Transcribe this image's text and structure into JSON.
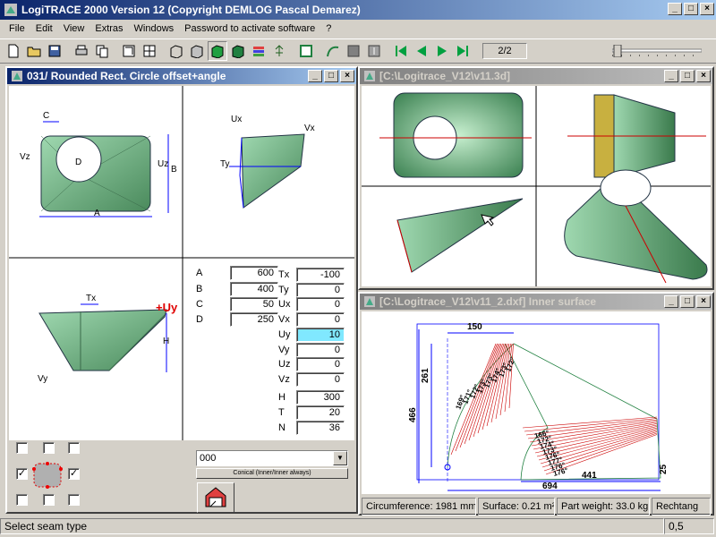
{
  "app": {
    "title": "LogiTRACE 2000  Version 12  (Copyright DEMLOG Pascal Demarez)"
  },
  "menu": [
    "File",
    "Edit",
    "View",
    "Extras",
    "Windows",
    "Password to activate software",
    "?"
  ],
  "toolbar": {
    "page_indicator": "2/2",
    "icons": [
      "new-file-icon",
      "open-folder-icon",
      "save-icon",
      "print-icon",
      "copy-icon",
      "view-2d-icon",
      "view-split-icon",
      "cube-wire-icon",
      "cube-solid-icon",
      "cube-green-icon",
      "cube-shade-icon",
      "layers-icon",
      "tree-icon",
      "frame-icon",
      "curve-icon",
      "gray-box-icon",
      "gray-key-icon",
      "first-icon",
      "prev-icon",
      "next-icon",
      "last-icon"
    ]
  },
  "left_panel": {
    "title": "031/ Rounded Rect. Circle offset+angle",
    "dims": {
      "A": "A",
      "B": "B",
      "C": "C",
      "D": "D",
      "Uz": "Uz",
      "Vz": "Vz",
      "Ux": "Ux",
      "Vx": "Vx",
      "Ty": "Ty",
      "Tx": "Tx",
      "Uy": "+Uy",
      "H": "H",
      "Vy": "Vy"
    },
    "params_left": [
      {
        "label": "A",
        "value": "600"
      },
      {
        "label": "B",
        "value": "400"
      },
      {
        "label": "C",
        "value": "50"
      },
      {
        "label": "D",
        "value": "250"
      }
    ],
    "params_right": [
      {
        "label": "Tx",
        "value": "-100"
      },
      {
        "label": "Ty",
        "value": "0"
      },
      {
        "label": "Ux",
        "value": "0"
      },
      {
        "label": "Vx",
        "value": "0"
      },
      {
        "label": "Uy",
        "value": "10"
      },
      {
        "label": "Vy",
        "value": "0"
      },
      {
        "label": "Uz",
        "value": "0"
      },
      {
        "label": "Vz",
        "value": "0"
      }
    ],
    "params_bottom": [
      {
        "label": "H",
        "value": "300"
      },
      {
        "label": "T",
        "value": "20"
      },
      {
        "label": "N",
        "value": "36"
      }
    ],
    "dropdown_value": "000",
    "tool_button": "Conical (Inner/Inner always)"
  },
  "panel_3d": {
    "title": "[C:\\Logitrace_V12\\v11.3d]"
  },
  "panel_dxf": {
    "title": "[C:\\Logitrace_V12\\v11_2.dxf]  Inner surface",
    "dims": {
      "d150": "150",
      "d261": "261",
      "d466": "466",
      "d441": "441",
      "d694": "694",
      "d25": "25"
    },
    "angles1": [
      "169°",
      "171°",
      "172°",
      "173°",
      "173°",
      "174°",
      "173°",
      "172°"
    ],
    "angles2": [
      "166°",
      "172°",
      "174°",
      "173°",
      "176°",
      "177°",
      "176°",
      "176°"
    ]
  },
  "info": {
    "circumference": "Circumference: 1981 mm",
    "surface": "Surface: 0.21 m²",
    "weight": "Part weight: 33.0 kg",
    "shape": "Rechtang"
  },
  "status": {
    "text": "Select seam type",
    "value": "0,5"
  }
}
